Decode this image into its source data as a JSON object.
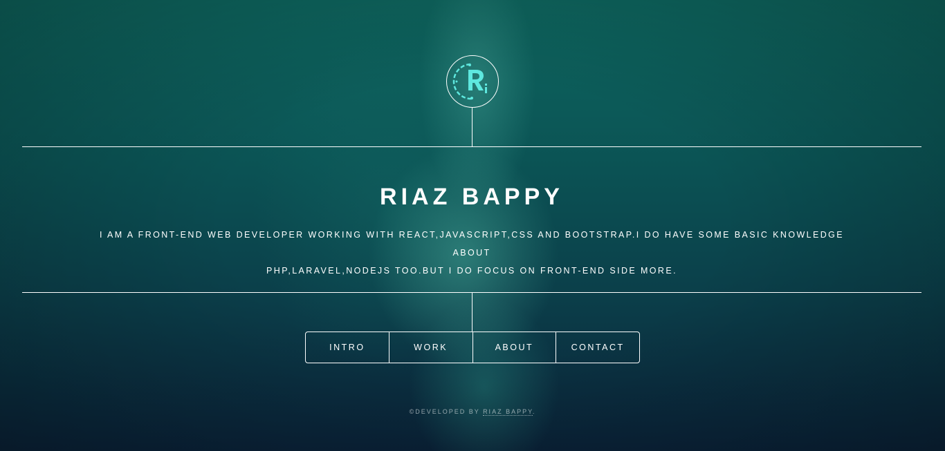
{
  "header": {
    "logo_icon": "ri-monogram-logo-icon",
    "logo_text": "Ri"
  },
  "main": {
    "name": "RIAZ BAPPY",
    "description_line1": "I am a front-end web developer working with React,Javascript,CSS and Bootstrap.I do have some basic knowledge about",
    "description_line2": "php,laravel,nodejs too.But I do focus on front-end side more."
  },
  "nav": {
    "items": [
      {
        "label": "INTRO"
      },
      {
        "label": "WORK"
      },
      {
        "label": "ABOUT"
      },
      {
        "label": "CONTACT"
      }
    ]
  },
  "footer": {
    "prefix": "©DEVELOPED BY ",
    "author": "RIAZ BAPPY",
    "suffix": "."
  },
  "colors": {
    "accent": "#5ee8df",
    "text": "#ffffff",
    "background_top": "#0e665f",
    "background_bottom": "#0a2238"
  }
}
